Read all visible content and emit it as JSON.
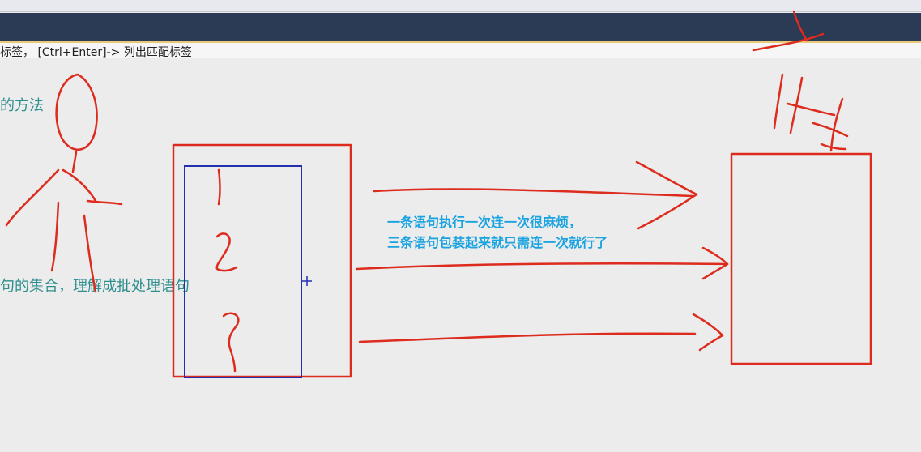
{
  "window": {
    "hint_text": "标签，  [Ctrl+Enter]-> 列出匹配标签"
  },
  "editor": {
    "lines": [
      "的方法",
      "句的集合，理解成批处理语句"
    ]
  },
  "annotations": {
    "line1": "一条语句执行一次连一次很麻烦，",
    "line2": "三条语句包装起来就只需连一次就行了"
  },
  "colors": {
    "ink_red": "#dd2b1e",
    "ink_blue": "#2230b0",
    "annotation_blue": "#1aa3e0",
    "editor_teal": "#2f8f8f",
    "titlebar": "#2b3a55"
  }
}
